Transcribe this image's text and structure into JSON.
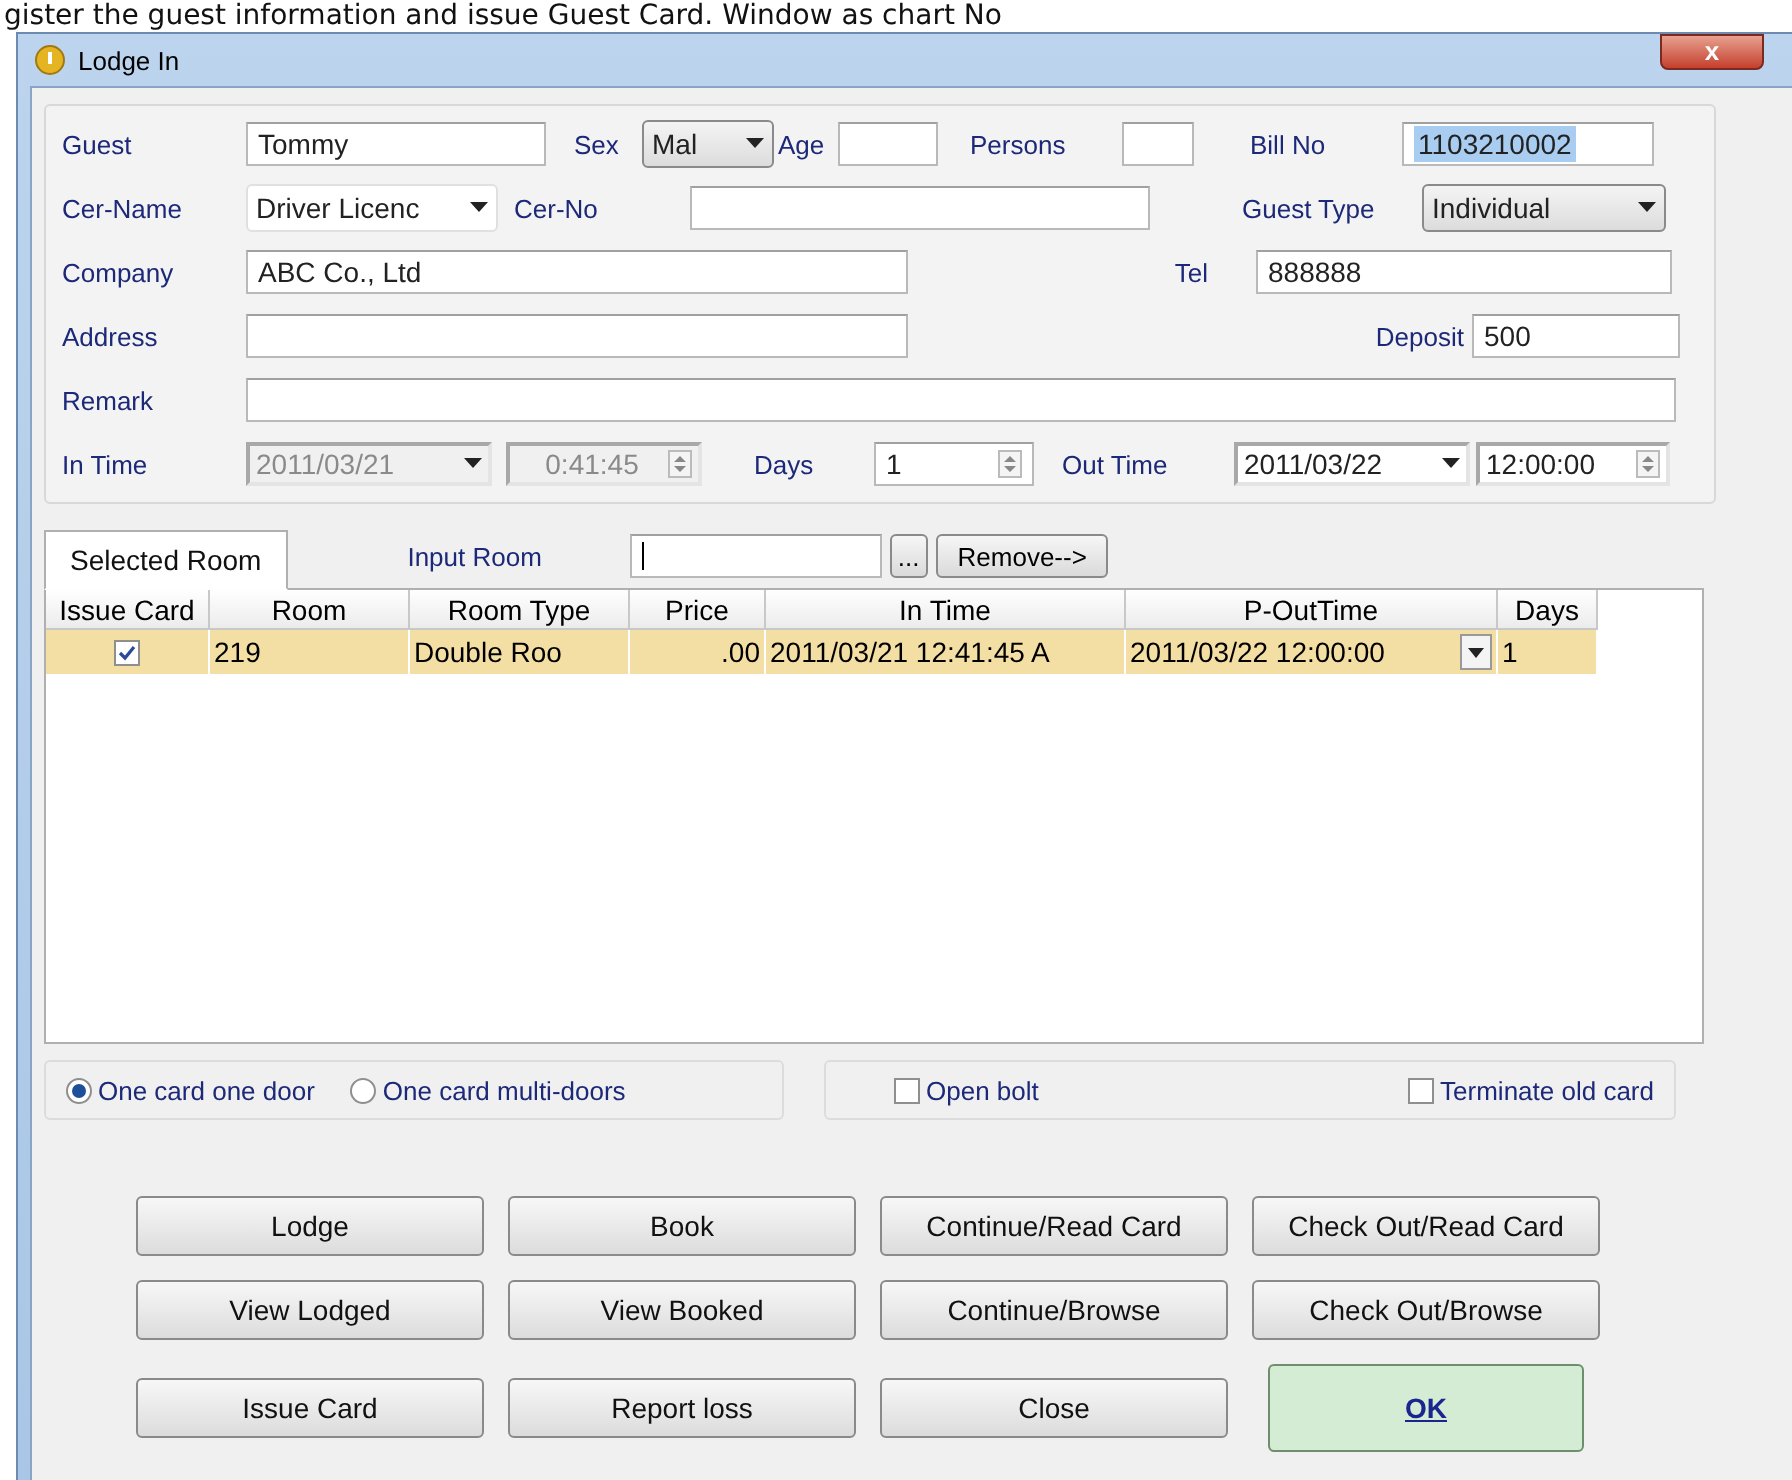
{
  "caption": "gister the guest information and issue Guest Card. Window as chart No",
  "window": {
    "title": "Lodge In",
    "close": "x"
  },
  "form": {
    "guest": {
      "label": "Guest",
      "value": "Tommy"
    },
    "sex": {
      "label": "Sex",
      "value": "Mal"
    },
    "age": {
      "label": "Age"
    },
    "persons": {
      "label": "Persons"
    },
    "bill_no": {
      "label": "Bill No",
      "value": "1103210002",
      "selected": true
    },
    "cer_name": {
      "label": "Cer-Name",
      "value": "Driver Licenc"
    },
    "cer_no": {
      "label": "Cer-No"
    },
    "guest_type": {
      "label": "Guest Type",
      "value": "Individual"
    },
    "company": {
      "label": "Company",
      "value": "ABC Co., Ltd"
    },
    "tel": {
      "label": "Tel",
      "value": "888888"
    },
    "address": {
      "label": "Address"
    },
    "deposit": {
      "label": "Deposit",
      "value": "500"
    },
    "remark": {
      "label": "Remark"
    },
    "in_time": {
      "label": "In Time",
      "date": "2011/03/21",
      "time": "0:41:45",
      "disabled": true
    },
    "days": {
      "label": "Days",
      "value": "1"
    },
    "out_time": {
      "label": "Out Time",
      "date": "2011/03/22",
      "time": "12:00:00",
      "disabled": false
    }
  },
  "tabs": [
    {
      "label": "Selected Room",
      "selected": true
    }
  ],
  "input_room": {
    "label": "Input Room",
    "browse": "...",
    "remove": "Remove-->"
  },
  "table": {
    "columns": [
      "Issue Card",
      "Room",
      "Room Type",
      "Price",
      "In Time",
      "P-OutTime",
      "Days"
    ],
    "rows": [
      {
        "issue_card": true,
        "selected": true,
        "room": "219",
        "room_type": "Double Roo",
        "price": ".00",
        "in_time": "2011/03/21 12:41:45 A",
        "out_time": "2011/03/22 12:00:00",
        "days": "1"
      }
    ]
  },
  "door_mode": [
    {
      "label": "One card one door",
      "selected": true
    },
    {
      "label": "One card multi-doors",
      "selected": false
    }
  ],
  "options": [
    {
      "label": "Open bolt",
      "checked": false
    },
    {
      "label": "Terminate old card",
      "checked": false
    }
  ],
  "buttons": [
    [
      {
        "label": "Lodge",
        "kind": "normal"
      },
      {
        "label": "Book",
        "kind": "normal"
      },
      {
        "label": "Continue/Read Card",
        "kind": "normal"
      },
      {
        "label": "Check Out/Read Card",
        "kind": "normal"
      }
    ],
    [
      {
        "label": "View Lodged",
        "kind": "normal"
      },
      {
        "label": "View Booked",
        "kind": "normal"
      },
      {
        "label": "Continue/Browse",
        "kind": "normal"
      },
      {
        "label": "Check Out/Browse",
        "kind": "normal"
      }
    ],
    [
      {
        "label": "Issue Card",
        "kind": "normal"
      },
      {
        "label": "Report loss",
        "kind": "normal"
      },
      {
        "label": "Close",
        "kind": "normal"
      },
      {
        "label": "OK",
        "kind": "primary"
      }
    ]
  ]
}
